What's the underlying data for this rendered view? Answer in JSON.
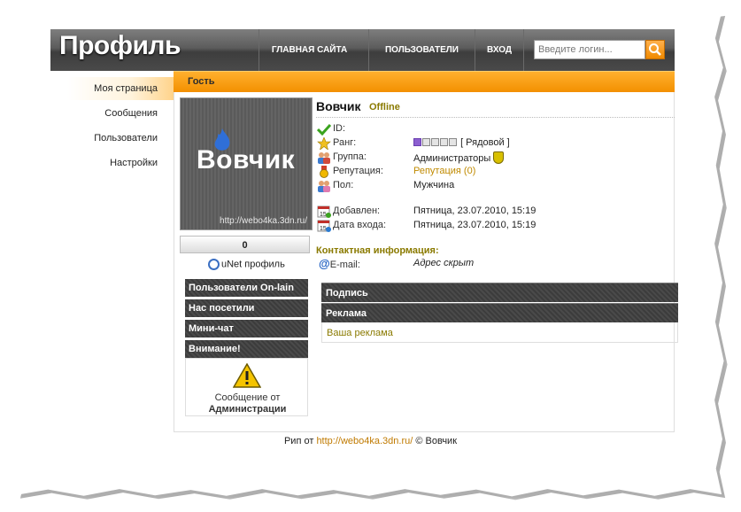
{
  "header": {
    "logo": "Профиль",
    "nav": {
      "home": "ГЛАВНАЯ САЙТА",
      "users": "ПОЛЬЗОВАТЕЛИ",
      "login": "ВХОД"
    },
    "search_placeholder": "Введите логин..."
  },
  "guest_bar": "Гость",
  "menu": [
    "Моя страница",
    "Сообщения",
    "Пользователи",
    "Настройки"
  ],
  "avatar": {
    "name": "Вовчик",
    "url": "http://webo4ka.3dn.ru/"
  },
  "count": "0",
  "unet_profile": "uNet профиль",
  "side_blocks": [
    "Пользователи On-lain",
    "Нас посетили",
    "Мини-чат",
    "Внимание!"
  ],
  "admin_message": {
    "line1": "Сообщение от",
    "line2": "Администрации"
  },
  "profile": {
    "name": "Вовчик",
    "status": "Offline",
    "rows": {
      "id_label": "ID:",
      "rank_label": "Ранг:",
      "rank_value": "[ Рядовой ]",
      "group_label": "Группа:",
      "group_value": "Администраторы",
      "rep_label": "Репутация:",
      "rep_value": "Репутация (0)",
      "sex_label": "Пол:",
      "sex_value": "Мужчина",
      "added_label": "Добавлен:",
      "added_value": "Пятница, 23.07.2010, 15:19",
      "login_label": "Дата входа:",
      "login_value": "Пятница, 23.07.2010, 15:19"
    },
    "contact_title": "Контактная информация:",
    "email_label": "E-mail:",
    "email_value": "Адрес скрыт"
  },
  "content_bars": [
    "Подпись",
    "Реклама"
  ],
  "ad_text": "Ваша реклама",
  "footer": {
    "prefix": "Рип от ",
    "link": "http://webo4ka.3dn.ru/",
    "suffix": " © Вовчик"
  },
  "colors": {
    "orange": "#f39000",
    "header_dark": "#4a4a4a",
    "accent_text": "#8a7a00"
  }
}
